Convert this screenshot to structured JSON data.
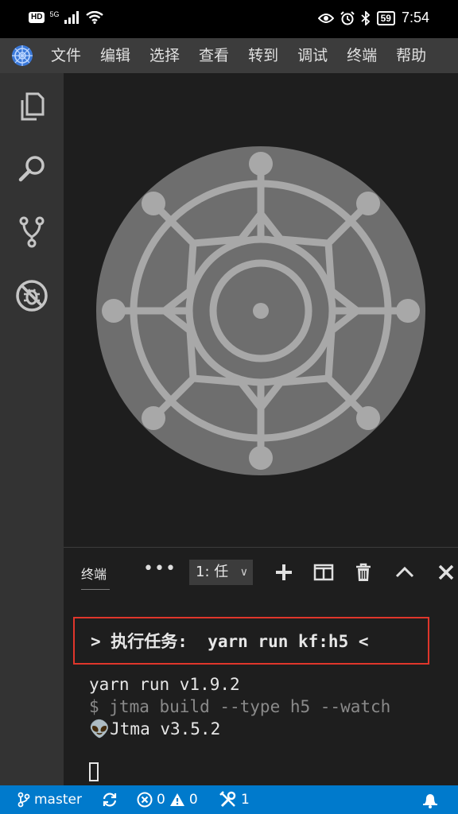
{
  "status": {
    "hd": "HD",
    "net": "5G",
    "battery": "59",
    "time": "7:54"
  },
  "menu": [
    "文件",
    "编辑",
    "选择",
    "查看",
    "转到",
    "调试",
    "终端",
    "帮助"
  ],
  "panel": {
    "tab_label": "终端",
    "more": "•••",
    "terminal_select": "1: 任",
    "chevron": "∨"
  },
  "terminal": {
    "task_line": "> 执行任务:  yarn run kf:h5 <",
    "lines": [
      "yarn run v1.9.2",
      "$ jtma build --type h5 --watch",
      "👽Jtma v3.5.2"
    ]
  },
  "statusbar": {
    "branch": "master",
    "errors": "0",
    "warnings": "0",
    "tools_count": "1"
  },
  "colors": {
    "menubar": "#3c3c3c",
    "activitybar": "#333333",
    "editor": "#1e1e1e",
    "statusbar": "#007acc",
    "highlight_border": "#e0362b",
    "logo_disc": "#6e6e6e",
    "logo_line": "#a8a8a8"
  },
  "icons": [
    "explorer-icon",
    "search-icon",
    "source-control-icon",
    "debug-icon",
    "branch-icon",
    "sync-icon",
    "error-icon",
    "warning-icon",
    "tools-icon",
    "bell-icon",
    "add-icon",
    "split-icon",
    "trash-icon",
    "chevron-up-icon",
    "close-icon"
  ]
}
